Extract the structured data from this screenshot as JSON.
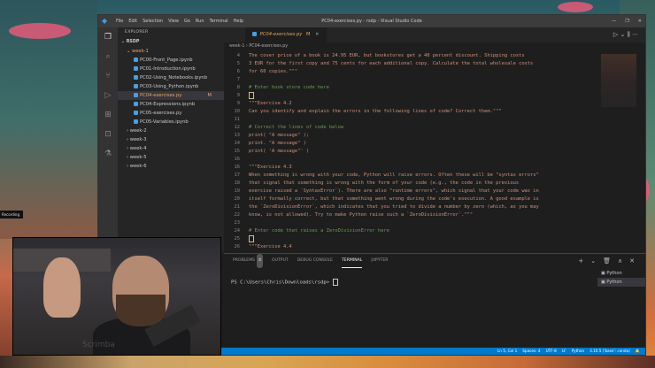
{
  "overlay": {
    "recording_label": "Recording"
  },
  "titlebar": {
    "menu": [
      "File",
      "Edit",
      "Selection",
      "View",
      "Go",
      "Run",
      "Terminal",
      "Help"
    ],
    "title": "PC04-exercises.py - rsdp - Visual Studio Code",
    "controls": [
      "—",
      "❐",
      "✕"
    ]
  },
  "activity_icons": [
    "files-icon",
    "search-icon",
    "source-control-icon",
    "run-debug-icon",
    "extensions-icon",
    "remote-icon",
    "testing-icon"
  ],
  "sidebar": {
    "header": "EXPLORER",
    "root": "RSDP",
    "tree": [
      {
        "label": "week-1",
        "type": "folder",
        "open": true,
        "modified": true
      },
      {
        "label": "PC00-Front_Page.ipynb",
        "type": "file"
      },
      {
        "label": "PC01-Introduction.ipynb",
        "type": "file"
      },
      {
        "label": "PC02-Using_Notebooks.ipynb",
        "type": "file"
      },
      {
        "label": "PC03-Using_Python.ipynb",
        "type": "file"
      },
      {
        "label": "PC04-exercises.py",
        "type": "file",
        "selected": true,
        "badge": "M"
      },
      {
        "label": "PC04-Expressions.ipynb",
        "type": "file"
      },
      {
        "label": "PC05-exercises.py",
        "type": "file"
      },
      {
        "label": "PC05-Variables.ipynb",
        "type": "file"
      },
      {
        "label": "week-2",
        "type": "folder"
      },
      {
        "label": "week-3",
        "type": "folder"
      },
      {
        "label": "week-4",
        "type": "folder"
      },
      {
        "label": "week-5",
        "type": "folder"
      },
      {
        "label": "week-6",
        "type": "folder"
      }
    ]
  },
  "editor": {
    "tab_label": "PC04-exercises.py",
    "tab_badge": "M",
    "breadcrumb": "week-1 › PC04-exercises.py",
    "lines": [
      {
        "n": "4",
        "kind": "doc",
        "text": "The cover price of a book is 24.95 EUR, but bookstores get a 40 percent discount. Shipping costs"
      },
      {
        "n": "5",
        "kind": "doc",
        "text": "3 EUR for the first copy and 75 cents for each additional copy. Calculate the total wholesale costs"
      },
      {
        "n": "6",
        "kind": "doc",
        "text": "for 60 copies.\"\"\""
      },
      {
        "n": "7",
        "kind": "plain",
        "text": ""
      },
      {
        "n": "8",
        "kind": "comment",
        "text": "# Enter book store code here"
      },
      {
        "n": "9",
        "kind": "cursor",
        "text": ""
      },
      {
        "n": "9",
        "kind": "doc",
        "text": "\"\"\"Exercise 4.2"
      },
      {
        "n": "10",
        "kind": "doc",
        "text": "Can you identify and explain the errors in the following lines of code? Correct them.\"\"\""
      },
      {
        "n": "11",
        "kind": "plain",
        "text": ""
      },
      {
        "n": "12",
        "kind": "comment",
        "text": "# Correct the lines of code below"
      },
      {
        "n": "13",
        "kind": "call",
        "text": "print( \"A message\" );"
      },
      {
        "n": "14",
        "kind": "call",
        "text": "print. \"A message\" )"
      },
      {
        "n": "15",
        "kind": "call",
        "text": "print( 'A message\"' )"
      },
      {
        "n": "16",
        "kind": "plain",
        "text": ""
      },
      {
        "n": "16",
        "kind": "doc",
        "text": "\"\"\"Exercise 4.3"
      },
      {
        "n": "17",
        "kind": "doc",
        "text": "When something is wrong with your code, Python will raise errors. Often these will be \"syntax errors\""
      },
      {
        "n": "18",
        "kind": "doc",
        "text": "that signal that something is wrong with the form of your code (e.g., the code in the previous"
      },
      {
        "n": "19",
        "kind": "doc",
        "text": "exercise raised a `SyntaxError`). There are also \"runtime errors\", which signal that your code was in"
      },
      {
        "n": "20",
        "kind": "doc",
        "text": "itself formally correct, but that something went wrong during the code's execution. A good example is"
      },
      {
        "n": "21",
        "kind": "doc",
        "text": "the `ZeroDivisionError`, which indicates that you tried to divide a number by zero (which, as you may"
      },
      {
        "n": "22",
        "kind": "doc",
        "text": "know, is not allowed). Try to make Python raise such a `ZeroDivisionError`.\"\"\""
      },
      {
        "n": "23",
        "kind": "plain",
        "text": ""
      },
      {
        "n": "24",
        "kind": "comment",
        "text": "# Enter code that raises a ZeroDivisionError here"
      },
      {
        "n": "25",
        "kind": "cursor",
        "text": ""
      },
      {
        "n": "26",
        "kind": "doc",
        "text": "\"\"\"Exercise 4.4"
      }
    ]
  },
  "panel": {
    "tabs": [
      "PROBLEMS",
      "OUTPUT",
      "DEBUG CONSOLE",
      "TERMINAL",
      "JUPYTER"
    ],
    "problems_count": "4",
    "active_tab": "TERMINAL",
    "prompt": "PS C:\\Users\\Chris\\Downloads\\rsdp> ",
    "terminals": [
      "Python",
      "Python"
    ],
    "tools": [
      "+",
      "⌄",
      "🗑",
      "∧",
      "✕"
    ]
  },
  "statusbar": {
    "items": [
      "Ln 5, Col 1",
      "Spaces: 4",
      "UTF-8",
      "LF",
      "Python",
      "3.10.5 ('base': conda)"
    ]
  },
  "webcam": {
    "logo": "Scrimba"
  }
}
